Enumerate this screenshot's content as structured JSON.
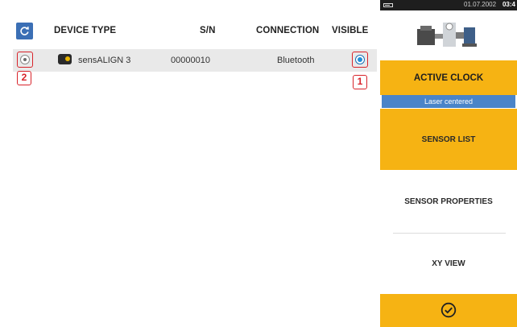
{
  "table": {
    "headers": {
      "device_type": "DEVICE TYPE",
      "sn": "S/N",
      "connection": "CONNECTION",
      "visible": "VISIBLE"
    },
    "rows": [
      {
        "device_type": "sensALIGN 3",
        "sn": "00000010",
        "connection": "Bluetooth",
        "selected": false,
        "visible": true
      }
    ]
  },
  "annotations": {
    "callout_1": "1",
    "callout_2": "2"
  },
  "status_bar": {
    "date": "01.07.2002",
    "time": "03:4"
  },
  "right_panel": {
    "active_clock": "ACTIVE CLOCK",
    "laser_status": "Laser centered",
    "nav": {
      "sensor_list": "SENSOR LIST",
      "sensor_properties": "SENSOR PROPERTIES",
      "xy_view": "XY VIEW"
    }
  },
  "colors": {
    "accent_yellow": "#f6b313",
    "status_blue": "#4a84c8",
    "annotation_red": "#d8232a",
    "refresh_blue": "#3b6fb5"
  },
  "icons": {
    "refresh": "refresh-icon",
    "sensor": "sensor-device-icon",
    "confirm": "check-circle-icon",
    "battery": "battery-icon",
    "machine": "machine-train-icon"
  }
}
